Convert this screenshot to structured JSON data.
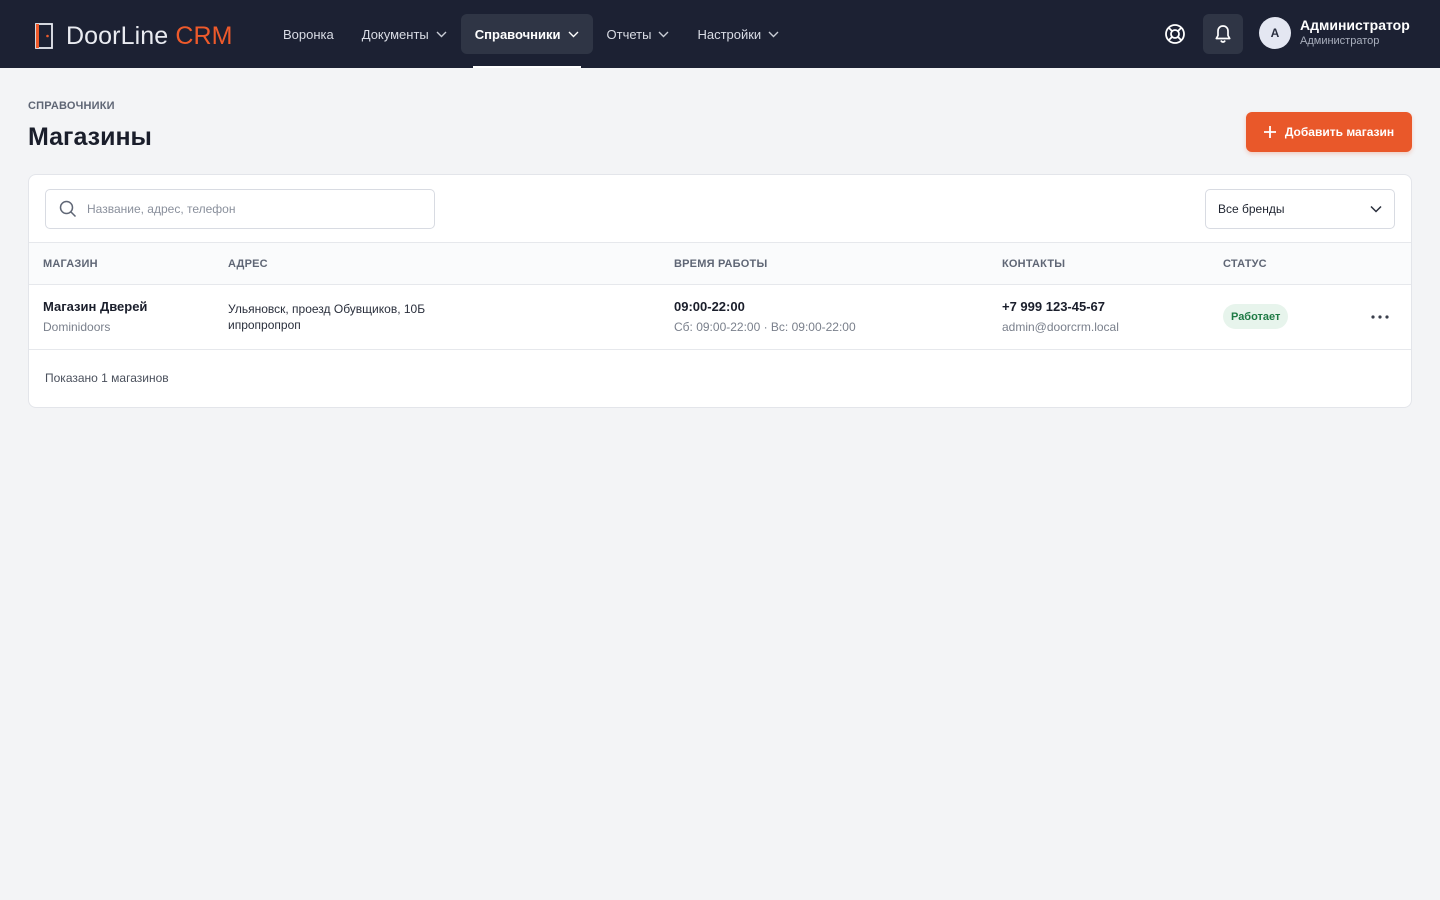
{
  "header": {
    "logo_main": "DoorLine",
    "logo_accent": "CRM",
    "nav": [
      {
        "label": "Воронка",
        "dropdown": false,
        "active": false
      },
      {
        "label": "Документы",
        "dropdown": true,
        "active": false
      },
      {
        "label": "Справочники",
        "dropdown": true,
        "active": true
      },
      {
        "label": "Отчеты",
        "dropdown": true,
        "active": false
      },
      {
        "label": "Настройки",
        "dropdown": true,
        "active": false
      }
    ],
    "icons": {
      "help": "lifebuoy-icon",
      "notifications": "bell-icon"
    },
    "user": {
      "initial": "А",
      "name": "Администратор",
      "role": "Администратор"
    }
  },
  "page": {
    "breadcrumb": "СПРАВОЧНИКИ",
    "title": "Магазины",
    "add_button": "Добавить магазин"
  },
  "filters": {
    "search_placeholder": "Название, адрес, телефон",
    "search_value": "",
    "brand_select": "Все бренды"
  },
  "table": {
    "columns": [
      "МАГАЗИН",
      "АДРЕС",
      "ВРЕМЯ РАБОТЫ",
      "КОНТАКТЫ",
      "СТАТУС"
    ],
    "rows": [
      {
        "store_name": "Магазин Дверей",
        "brand": "Dominidoors",
        "address_line1": "Ульяновск, проезд Обувщиков, 10Б",
        "address_line2": "ипропропроп",
        "hours_main": "09:00-22:00",
        "hours_weekend": "Сб: 09:00-22:00 · Вс: 09:00-22:00",
        "phone": "+7 999 123-45-67",
        "email": "admin@doorcrm.local",
        "status": "Работает"
      }
    ]
  },
  "footer": {
    "count_text": "Показано 1 магазинов"
  },
  "colors": {
    "topbar": "#1c2133",
    "accent": "#e9582a",
    "status_ok_bg": "#e7f4ec",
    "status_ok_text": "#1e7a45"
  }
}
